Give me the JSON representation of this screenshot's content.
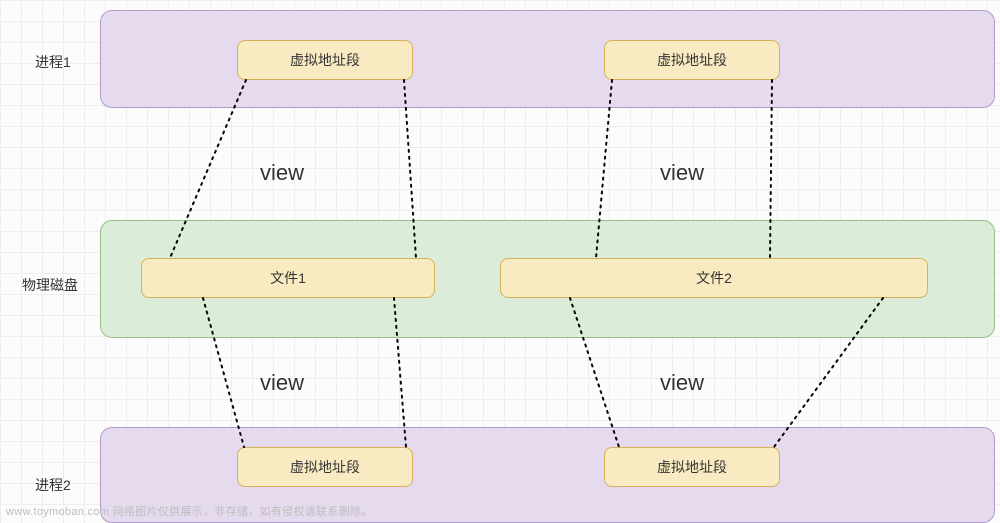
{
  "labels": {
    "process1": "进程1",
    "process2": "进程2",
    "disk": "物理磁盘"
  },
  "view_text": "view",
  "boxes": {
    "vaddr": "虚拟地址段",
    "file1": "文件1",
    "file2": "文件2"
  },
  "watermark": "www.toymoban.com 网络图片仅供展示，非存储，如有侵权请联系删除。",
  "chart_data": {
    "type": "diagram",
    "nodes": [
      {
        "id": "proc1",
        "label": "进程1",
        "kind": "container"
      },
      {
        "id": "proc2",
        "label": "进程2",
        "kind": "container"
      },
      {
        "id": "disk",
        "label": "物理磁盘",
        "kind": "container"
      },
      {
        "id": "p1_va1",
        "label": "虚拟地址段",
        "parent": "proc1"
      },
      {
        "id": "p1_va2",
        "label": "虚拟地址段",
        "parent": "proc1"
      },
      {
        "id": "p2_va1",
        "label": "虚拟地址段",
        "parent": "proc2"
      },
      {
        "id": "p2_va2",
        "label": "虚拟地址段",
        "parent": "proc2"
      },
      {
        "id": "file1",
        "label": "文件1",
        "parent": "disk"
      },
      {
        "id": "file2",
        "label": "文件2",
        "parent": "disk"
      }
    ],
    "edges": [
      {
        "from": "p1_va1",
        "to": "file1",
        "label": "view"
      },
      {
        "from": "p1_va2",
        "to": "file2",
        "label": "view"
      },
      {
        "from": "p2_va1",
        "to": "file1",
        "label": "view"
      },
      {
        "from": "p2_va2",
        "to": "file2",
        "label": "view"
      }
    ]
  }
}
